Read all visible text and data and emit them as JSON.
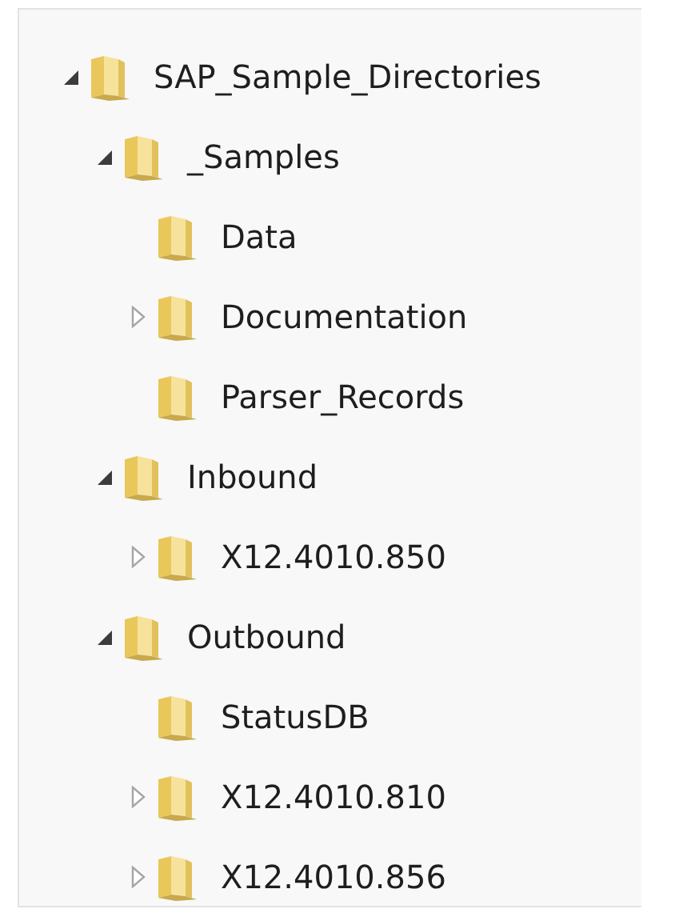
{
  "tree": [
    {
      "label": "SAP_Sample_Directories",
      "kind": "expandable",
      "expanded": true,
      "children": [
        {
          "label": "_Samples",
          "kind": "expandable",
          "expanded": true,
          "children": [
            {
              "label": "Data",
              "kind": "leaf"
            },
            {
              "label": "Documentation",
              "kind": "expandable",
              "expanded": false
            },
            {
              "label": "Parser_Records",
              "kind": "leaf"
            }
          ]
        },
        {
          "label": "Inbound",
          "kind": "expandable",
          "expanded": true,
          "children": [
            {
              "label": "X12.4010.850",
              "kind": "expandable",
              "expanded": false
            }
          ]
        },
        {
          "label": "Outbound",
          "kind": "expandable",
          "expanded": true,
          "children": [
            {
              "label": "StatusDB",
              "kind": "leaf"
            },
            {
              "label": "X12.4010.810",
              "kind": "expandable",
              "expanded": false
            },
            {
              "label": "X12.4010.856",
              "kind": "expandable",
              "expanded": false
            }
          ]
        }
      ]
    }
  ]
}
